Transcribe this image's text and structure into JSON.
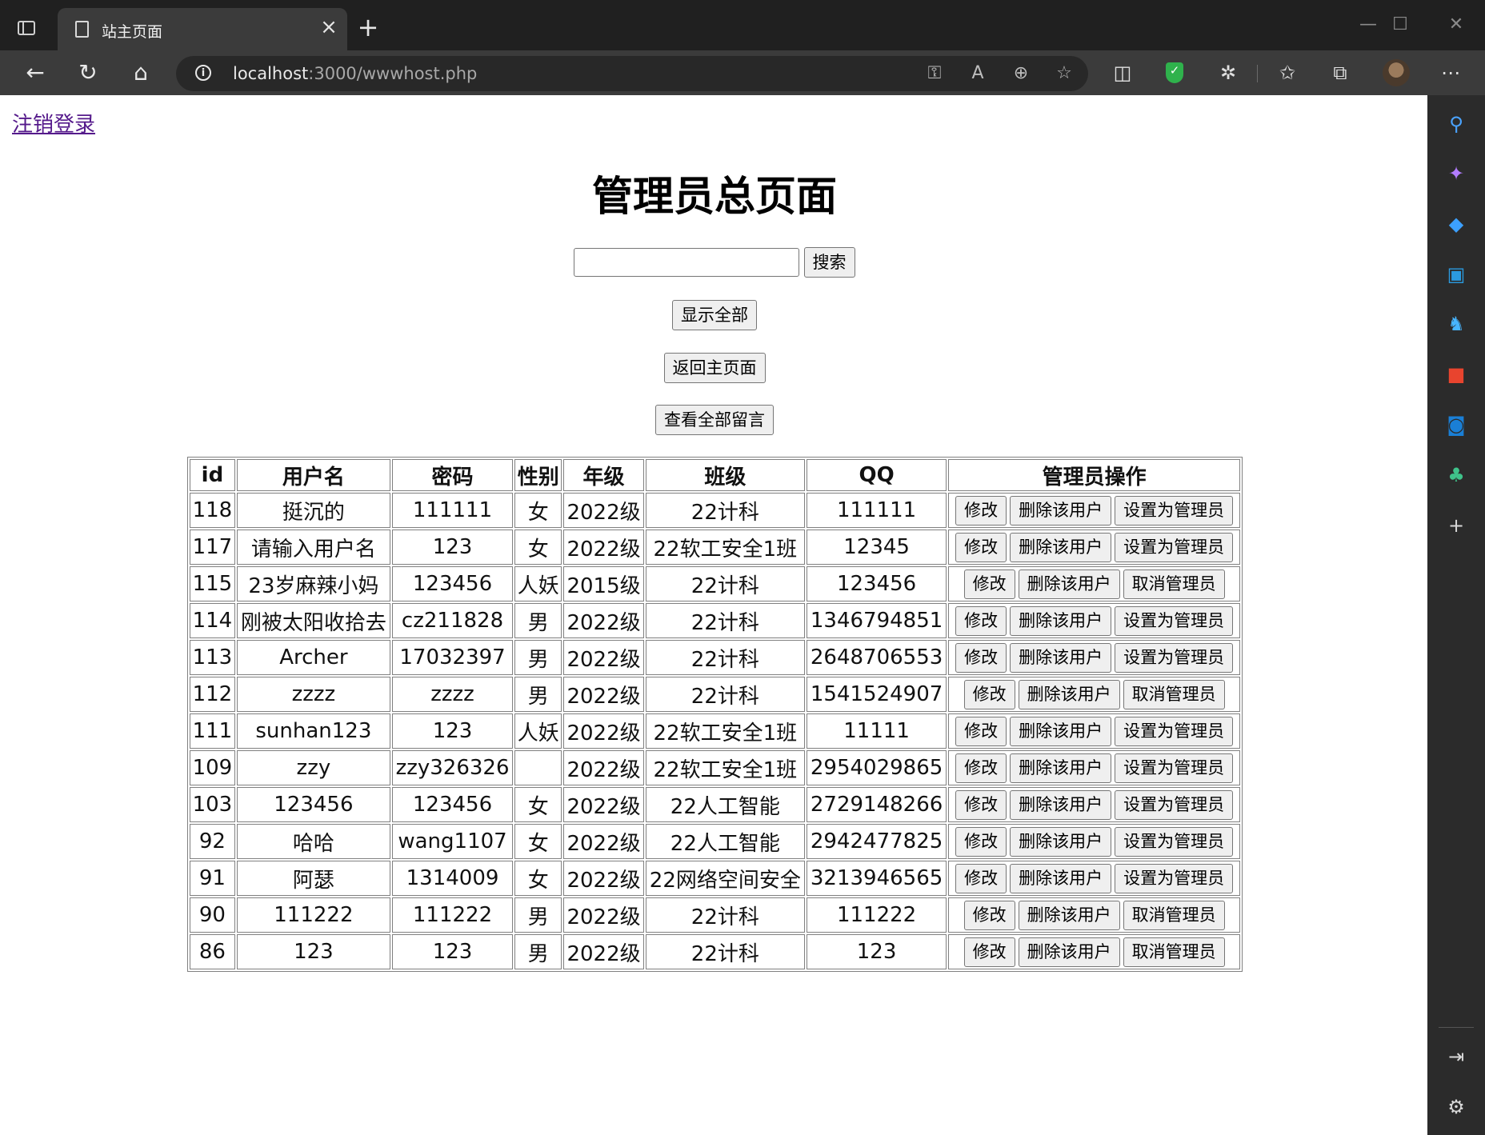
{
  "browser": {
    "tab_title": "站主页面",
    "url_host": "localhost",
    "url_rest": ":3000/wwwhost.php",
    "theme": {
      "chrome_bg": "#202020",
      "toolbar_bg": "#3b3b3b",
      "accent_green": "#2fb24c"
    }
  },
  "page": {
    "logout_link": "注销登录",
    "title": "管理员总页面",
    "search": {
      "placeholder": "",
      "value": "",
      "button": "搜索"
    },
    "show_all_button": "显示全部",
    "back_home_button": "返回主页面",
    "view_messages_button": "查看全部留言"
  },
  "table": {
    "headers": [
      "id",
      "用户名",
      "密码",
      "性别",
      "年级",
      "班级",
      "QQ",
      "管理员操作"
    ],
    "rows": [
      {
        "id": "118",
        "username": "挺沉的",
        "password": "111111",
        "gender": "女",
        "grade": "2022级",
        "class": "22计科",
        "qq": "111111",
        "edit": "修改",
        "delete": "删除该用户",
        "admin_action": "设置为管理员"
      },
      {
        "id": "117",
        "username": "请输入用户名",
        "password": "123",
        "gender": "女",
        "grade": "2022级",
        "class": "22软工安全1班",
        "qq": "12345",
        "edit": "修改",
        "delete": "删除该用户",
        "admin_action": "设置为管理员"
      },
      {
        "id": "115",
        "username": "23岁麻辣小妈",
        "password": "123456",
        "gender": "人妖",
        "grade": "2015级",
        "class": "22计科",
        "qq": "123456",
        "edit": "修改",
        "delete": "删除该用户",
        "admin_action": "取消管理员"
      },
      {
        "id": "114",
        "username": "刚被太阳收拾去",
        "password": "cz211828",
        "gender": "男",
        "grade": "2022级",
        "class": "22计科",
        "qq": "1346794851",
        "edit": "修改",
        "delete": "删除该用户",
        "admin_action": "设置为管理员"
      },
      {
        "id": "113",
        "username": "Archer",
        "password": "17032397",
        "gender": "男",
        "grade": "2022级",
        "class": "22计科",
        "qq": "2648706553",
        "edit": "修改",
        "delete": "删除该用户",
        "admin_action": "设置为管理员"
      },
      {
        "id": "112",
        "username": "zzzz",
        "password": "zzzz",
        "gender": "男",
        "grade": "2022级",
        "class": "22计科",
        "qq": "1541524907",
        "edit": "修改",
        "delete": "删除该用户",
        "admin_action": "取消管理员"
      },
      {
        "id": "111",
        "username": "sunhan123",
        "password": "123",
        "gender": "人妖",
        "grade": "2022级",
        "class": "22软工安全1班",
        "qq": "11111",
        "edit": "修改",
        "delete": "删除该用户",
        "admin_action": "设置为管理员"
      },
      {
        "id": "109",
        "username": "zzy",
        "password": "zzy326326",
        "gender": "",
        "grade": "2022级",
        "class": "22软工安全1班",
        "qq": "2954029865",
        "edit": "修改",
        "delete": "删除该用户",
        "admin_action": "设置为管理员"
      },
      {
        "id": "103",
        "username": "123456",
        "password": "123456",
        "gender": "女",
        "grade": "2022级",
        "class": "22人工智能",
        "qq": "2729148266",
        "edit": "修改",
        "delete": "删除该用户",
        "admin_action": "设置为管理员"
      },
      {
        "id": "92",
        "username": "哈哈",
        "password": "wang1107",
        "gender": "女",
        "grade": "2022级",
        "class": "22人工智能",
        "qq": "2942477825",
        "edit": "修改",
        "delete": "删除该用户",
        "admin_action": "设置为管理员"
      },
      {
        "id": "91",
        "username": "阿瑟",
        "password": "1314009",
        "gender": "女",
        "grade": "2022级",
        "class": "22网络空间安全",
        "qq": "3213946565",
        "edit": "修改",
        "delete": "删除该用户",
        "admin_action": "设置为管理员"
      },
      {
        "id": "90",
        "username": "111222",
        "password": "111222",
        "gender": "男",
        "grade": "2022级",
        "class": "22计科",
        "qq": "111222",
        "edit": "修改",
        "delete": "删除该用户",
        "admin_action": "取消管理员"
      },
      {
        "id": "86",
        "username": "123",
        "password": "123",
        "gender": "男",
        "grade": "2022级",
        "class": "22计科",
        "qq": "123",
        "edit": "修改",
        "delete": "删除该用户",
        "admin_action": "取消管理员"
      }
    ]
  },
  "icons": {
    "tab_actions": "tab-actions-icon",
    "document": "document-icon",
    "back": "back-arrow-icon",
    "refresh": "refresh-icon",
    "home": "home-icon",
    "info": "info-icon",
    "sidebar": [
      "search-icon",
      "copilot-icon",
      "shopping-tag-icon",
      "tools-icon",
      "games-icon",
      "office-icon",
      "outlook-icon",
      "tree-icon",
      "add-icon",
      "hide-sidebar-icon",
      "settings-icon"
    ]
  }
}
